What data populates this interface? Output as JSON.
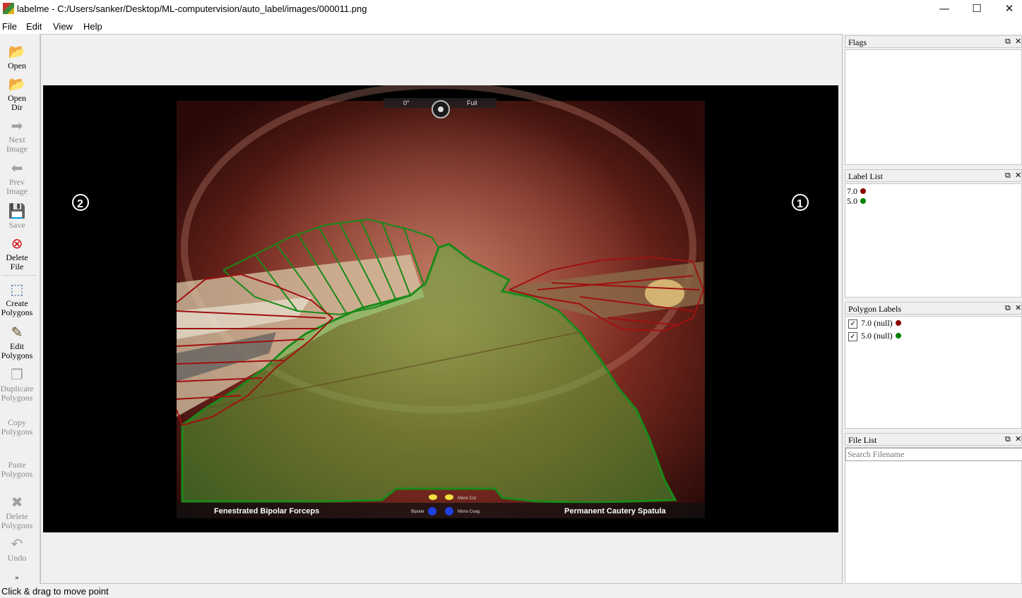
{
  "window": {
    "title": "labelme - C:/Users/sanker/Desktop/ML-computervision/auto_label/images/000011.png",
    "minimize": "—",
    "maximize": "☐",
    "close": "✕"
  },
  "menu": {
    "file": "File",
    "edit": "Edit",
    "view": "View",
    "help": "Help"
  },
  "toolbar": {
    "open": {
      "l1": "Open",
      "l2": ""
    },
    "open_dir": {
      "l1": "Open",
      "l2": "Dir"
    },
    "next_image": {
      "l1": "Next",
      "l2": "Image"
    },
    "prev_image": {
      "l1": "Prev",
      "l2": "Image"
    },
    "save": {
      "l1": "Save",
      "l2": ""
    },
    "delete_file": {
      "l1": "Delete",
      "l2": "File"
    },
    "create_polygons": {
      "l1": "Create",
      "l2": "Polygons"
    },
    "edit_polygons": {
      "l1": "Edit",
      "l2": "Polygons"
    },
    "duplicate_polygons": {
      "l1": "Duplicate",
      "l2": "Polygons"
    },
    "copy_polygons": {
      "l1": "Copy",
      "l2": "Polygons"
    },
    "paste_polygons": {
      "l1": "Paste",
      "l2": "Polygons"
    },
    "delete_polygons": {
      "l1": "Delete",
      "l2": "Polygons"
    },
    "undo": {
      "l1": "Undo",
      "l2": ""
    },
    "more": "»"
  },
  "image_overlay": {
    "hud_angle": "0°",
    "hud_zoom": "Full",
    "marker_left": "2",
    "marker_right": "1",
    "left_instrument": "Fenestrated Bipolar Forceps",
    "right_instrument": "Permanent Cautery Spatula",
    "mono_cut": "Mono Cut",
    "mono_coag": "Mono Coag",
    "bipolar": "Bipolar"
  },
  "colors": {
    "label_red": "#8b0000",
    "label_green": "#008000",
    "poly_fill": "rgba(80,190,60,0.45)"
  },
  "panels": {
    "flags": {
      "title": "Flags",
      "float": "⧉",
      "close": "✕"
    },
    "label_list": {
      "title": "Label List",
      "float": "⧉",
      "close": "✕",
      "items": [
        {
          "label": "7.0",
          "color": "#8b0000"
        },
        {
          "label": "5.0",
          "color": "#008000"
        }
      ]
    },
    "polygon_labels": {
      "title": "Polygon Labels",
      "float": "⧉",
      "close": "✕",
      "items": [
        {
          "label": "7.0 (null)",
          "checked": true,
          "color": "#8b0000"
        },
        {
          "label": "5.0 (null)",
          "checked": true,
          "color": "#008000"
        }
      ]
    },
    "file_list": {
      "title": "File List",
      "float": "⧉",
      "close": "✕",
      "search_placeholder": "Search Filename"
    }
  },
  "status": {
    "text": "Click & drag to move point"
  }
}
